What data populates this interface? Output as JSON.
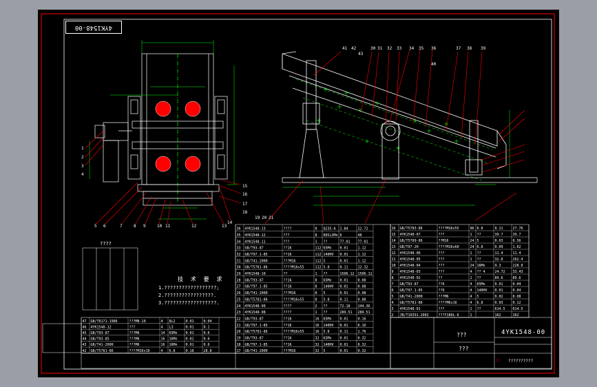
{
  "drawing_number_box": "4YK1548-00",
  "technical_requirements": {
    "title": "技 术 要 求",
    "lines": [
      "1.??????????????????;",
      "2.?????????????????.",
      "3.??????????????????."
    ]
  },
  "small_table_title": "????",
  "title_block": {
    "drawing_number": "4YK1548-00",
    "name": "???",
    "company": "???",
    "footer": "??????????"
  },
  "colors": {
    "background": "#000000",
    "line": "#ffffff",
    "frame": "#ff0000",
    "leader": "#ff0000",
    "dimension": "#00ff00",
    "circle_fill": "#ff0000"
  },
  "part_numbers_left": [
    "1",
    "2",
    "3",
    "4",
    "5",
    "6",
    "7",
    "8",
    "9",
    "10",
    "11",
    "12",
    "13",
    "14",
    "15",
    "16",
    "17",
    "18",
    "19",
    "20",
    "21"
  ],
  "part_numbers_right_top": [
    "41",
    "42",
    "43",
    "30",
    "31",
    "32",
    "33",
    "34",
    "35",
    "36",
    "37",
    "38",
    "39",
    "40"
  ],
  "bom_rows_left": [
    {
      "no": "47",
      "code": "GB/T6171-1986",
      "name": "???M8-10",
      "qty": "4",
      "mat": "8L2",
      "w1": "0.01",
      "w2": "0.04"
    },
    {
      "no": "46",
      "code": "4YK1548-12",
      "name": "???",
      "qty": "4",
      "mat": "L3",
      "w1": "0.01",
      "w2": "0.1"
    },
    {
      "no": "45",
      "code": "GB/T93-87",
      "name": "???M6",
      "qty": "14",
      "mat": "65Mn",
      "w1": "0.01",
      "w2": "0.6"
    },
    {
      "no": "44",
      "code": "GB/T93-85",
      "name": "???M6",
      "qty": "16",
      "mat": "16Mn",
      "w1": "0.01",
      "w2": "0.6"
    },
    {
      "no": "43",
      "code": "GB/T41-2000",
      "name": "???M6",
      "qty": "16",
      "mat": "16Mn",
      "w1": "0.01",
      "w2": "0.6"
    },
    {
      "no": "42",
      "code": "GB/T5781-86",
      "name": "????M16x16",
      "qty": "4",
      "mat": "6.8",
      "w1": "0.18",
      "w2": "28.8"
    }
  ],
  "bom_rows_middle": [
    {
      "no": "36",
      "code": "4YK1548-13",
      "name": "????",
      "qty": "8",
      "mat": "Q235-A",
      "w1": "2.84",
      "w2": "22.72"
    },
    {
      "no": "35",
      "code": "4YK1548-12",
      "name": "???",
      "qty": "8",
      "mat": "60Si2Mn",
      "w1": "6",
      "w2": "48"
    },
    {
      "no": "34",
      "code": "4YK1548-11",
      "name": "???",
      "qty": "1",
      "mat": "??",
      "w1": "77.01",
      "w2": "77.01"
    },
    {
      "no": "33",
      "code": "GB/T93-87",
      "name": "??16",
      "qty": "112",
      "mat": "65Mn",
      "w1": "0.01",
      "w2": "1.12"
    },
    {
      "no": "32",
      "code": "GB/T97.1-85",
      "name": "??16",
      "qty": "112",
      "mat": "140HV",
      "w1": "0.01",
      "w2": "1.12"
    },
    {
      "no": "31",
      "code": "GB/T41-2000",
      "name": "???M16",
      "qty": "112",
      "mat": "5",
      "w1": "0.01",
      "w2": "1.12"
    },
    {
      "no": "30",
      "code": "GB/T5781-86",
      "name": "????M16x55",
      "qty": "112",
      "mat": "5.8",
      "w1": "0.11",
      "w2": "12.32"
    },
    {
      "no": "29",
      "code": "4YK1548-10",
      "name": "??",
      "qty": "1",
      "mat": "??",
      "w1": "1506.12",
      "w2": "1506.12"
    },
    {
      "no": "28",
      "code": "GB/T93-87",
      "name": "??16",
      "qty": "8",
      "mat": "65Mn",
      "w1": "0.01",
      "w2": "0.08"
    },
    {
      "no": "27",
      "code": "GB/T97.1-85",
      "name": "??16",
      "qty": "8",
      "mat": "140HV",
      "w1": "0.01",
      "w2": "0.08"
    },
    {
      "no": "26",
      "code": "GB/T41-2000",
      "name": "???M16",
      "qty": "8",
      "mat": "5",
      "w1": "0.01",
      "w2": "0.08"
    },
    {
      "no": "25",
      "code": "GB/T5781-86",
      "name": "????M16x55",
      "qty": "8",
      "mat": "5.8",
      "w1": "0.11",
      "w2": "0.88"
    },
    {
      "no": "24",
      "code": "4YK1548-09",
      "name": "????",
      "qty": "2",
      "mat": "??",
      "w1": "72.18",
      "w2": "144.36"
    },
    {
      "no": "23",
      "code": "4YK1548-08",
      "name": "????",
      "qty": "1",
      "mat": "??",
      "w1": "289.51",
      "w2": "289.51"
    },
    {
      "no": "22",
      "code": "GB/T93-87",
      "name": "??16",
      "qty": "16",
      "mat": "65Mn",
      "w1": "0.01",
      "w2": "0.16"
    },
    {
      "no": "21",
      "code": "GB/T97.1-85",
      "name": "??16",
      "qty": "16",
      "mat": "140HV",
      "w1": "0.01",
      "w2": "0.16"
    },
    {
      "no": "20",
      "code": "GB/T5781-86",
      "name": "????M16x55",
      "qty": "16",
      "mat": "5.8",
      "w1": "0.11",
      "w2": "1.76"
    },
    {
      "no": "19",
      "code": "GB/T93-87",
      "name": "??16",
      "qty": "32",
      "mat": "65Mn",
      "w1": "0.01",
      "w2": "0.32"
    },
    {
      "no": "18",
      "code": "GB/T97.1-85",
      "name": "??16",
      "qty": "32",
      "mat": "140HV",
      "w1": "0.01",
      "w2": "0.32"
    },
    {
      "no": "17",
      "code": "GB/T41-2000",
      "name": "???M16",
      "qty": "32",
      "mat": "5",
      "w1": "0.01",
      "w2": "0.32"
    }
  ],
  "bom_rows_right": [
    {
      "no": "16",
      "code": "GB/T5783-86",
      "name": "????M16x55",
      "qty": "96",
      "mat": "6.8",
      "w1": "0.11",
      "w2": "27.76"
    },
    {
      "no": "15",
      "code": "4YK1548-07",
      "name": "???",
      "qty": "1",
      "mat": "??",
      "w1": "39.7",
      "w2": "39.7"
    },
    {
      "no": "14",
      "code": "GB/T5789-86",
      "name": "??M16",
      "qty": "24",
      "mat": "5",
      "w1": "0.03",
      "w2": "0.56"
    },
    {
      "no": "13",
      "code": "GB/T97-2H",
      "name": "????M16x60",
      "qty": "24",
      "mat": "6.8",
      "w1": "0.09",
      "w2": "1.62"
    },
    {
      "no": "12",
      "code": "4YK1548-06",
      "name": "???",
      "qty": "1",
      "mat": "??",
      "w1": "11.4",
      "w2": "11.4"
    },
    {
      "no": "11",
      "code": "4YK1548-05",
      "name": "???",
      "qty": "1",
      "mat": "??",
      "w1": "32.8",
      "w2": "262.4"
    },
    {
      "no": "10",
      "code": "4YK1548-04",
      "name": "???",
      "qty": "24",
      "mat": "16Mn",
      "w1": "9.3",
      "w2": "228.8"
    },
    {
      "no": "9",
      "code": "4YK1548-03",
      "name": "???",
      "qty": "4",
      "mat": "?? 4",
      "w1": "24.72",
      "w2": "33.43"
    },
    {
      "no": "8",
      "code": "4YK1548-02",
      "name": "??",
      "qty": "1",
      "mat": "??",
      "w1": "89.6",
      "w2": "89.6"
    },
    {
      "no": "7",
      "code": "GB/T93-87",
      "name": "??6",
      "qty": "4",
      "mat": "65Mn",
      "w1": "0.01",
      "w2": "0.04"
    },
    {
      "no": "6",
      "code": "GB/T97.1-85",
      "name": "??6",
      "qty": "4",
      "mat": "140HV",
      "w1": "0.01",
      "w2": "0.04"
    },
    {
      "no": "5",
      "code": "GB/T41-2000",
      "name": "???M6",
      "qty": "4",
      "mat": "5",
      "w1": "0.02",
      "w2": "0.08"
    },
    {
      "no": "4",
      "code": "GB/T5781-86",
      "name": "????M6x16",
      "qty": "4",
      "mat": "6.8",
      "w1": "0.03",
      "w2": "0.12"
    },
    {
      "no": "3",
      "code": "4YK1548-01",
      "name": "???",
      "qty": "1",
      "mat": "??",
      "w1": "614.5",
      "w2": "614.5"
    },
    {
      "no": "2",
      "code": "JB/T10391-2002",
      "name": "???Y180L-6",
      "qty": "1",
      "mat": "",
      "w1": "162",
      "w2": "162"
    }
  ]
}
